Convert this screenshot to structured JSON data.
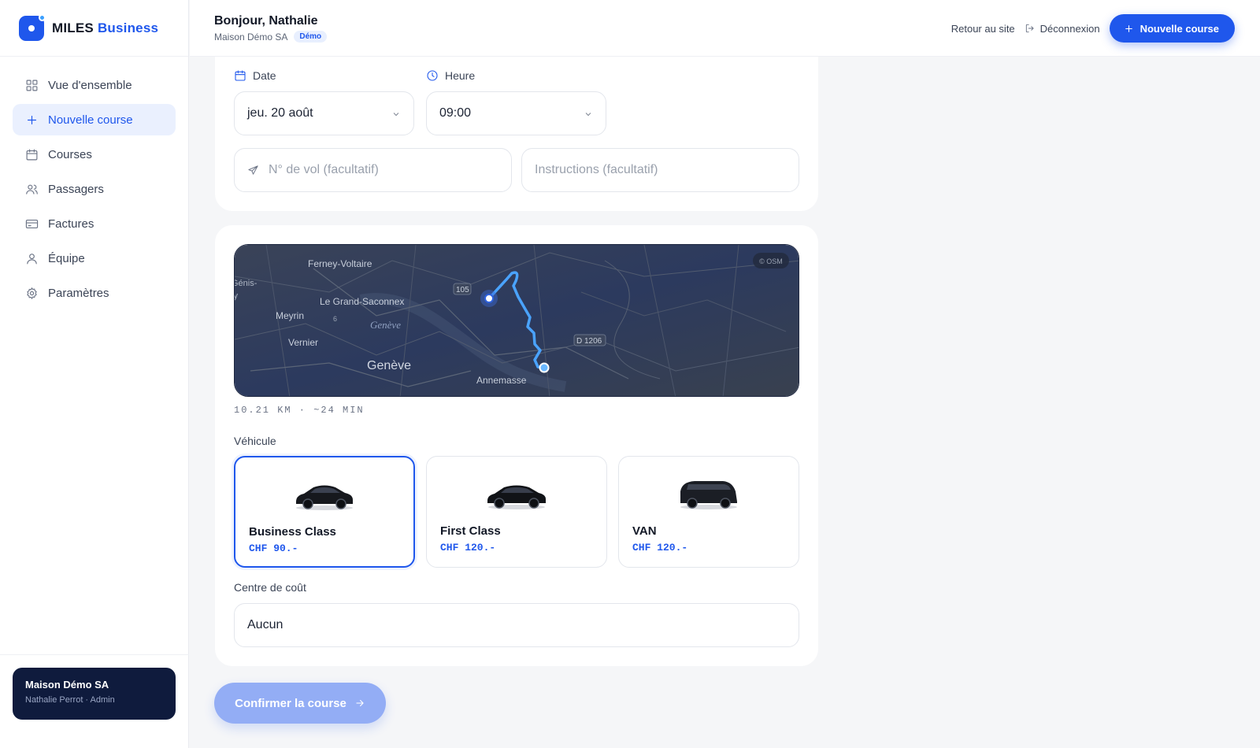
{
  "brand": {
    "name_part1": "MILES",
    "name_part2": "Business"
  },
  "sidebar": {
    "items": [
      {
        "label": "Vue d'ensemble",
        "icon": "grid-icon"
      },
      {
        "label": "Nouvelle course",
        "icon": "plus-icon",
        "active": true
      },
      {
        "label": "Courses",
        "icon": "calendar-icon"
      },
      {
        "label": "Passagers",
        "icon": "users-icon"
      },
      {
        "label": "Factures",
        "icon": "credit-card-icon"
      },
      {
        "label": "Équipe",
        "icon": "user-icon"
      },
      {
        "label": "Paramètres",
        "icon": "gear-icon"
      }
    ],
    "org_card": {
      "name": "Maison Démo SA",
      "sub": "Nathalie Perrot · Admin"
    }
  },
  "header": {
    "greeting": "Bonjour, Nathalie",
    "company": "Maison Démo SA",
    "badge": "Démo",
    "back_link": "Retour au site",
    "logout": "Déconnexion",
    "new_ride": "Nouvelle course"
  },
  "form": {
    "date_label": "Date",
    "date_value": "jeu. 20 août",
    "time_label": "Heure",
    "time_value": "09:00",
    "flight_placeholder": "N° de vol (facultatif)",
    "instructions_placeholder": "Instructions (facultatif)"
  },
  "map": {
    "labels": {
      "ferney": "Ferney-Voltaire",
      "genis": "Génis-",
      "genis2": "ly",
      "grand_saconnex": "Le Grand-Saconnex",
      "meyrin": "Meyrin",
      "geneve_lake": "Genève",
      "vernier": "Vernier",
      "geneve": "Genève",
      "annemasse": "Annemasse",
      "road_105": "105",
      "road_d1206": "D 1206",
      "road_6": "6"
    },
    "attribution": "© OSM"
  },
  "route_info": "10.21 KM · ~24 MIN",
  "vehicle": {
    "label": "Véhicule",
    "options": [
      {
        "name": "Business Class",
        "price": "CHF 90.-",
        "selected": true
      },
      {
        "name": "First Class",
        "price": "CHF 120.-",
        "selected": false
      },
      {
        "name": "VAN",
        "price": "CHF 120.-",
        "selected": false
      }
    ]
  },
  "cost_center": {
    "label": "Centre de coût",
    "value": "Aucun"
  },
  "confirm_label": "Confirmer la course",
  "colors": {
    "accent": "#1f57ec",
    "sidebar_card": "#0f1b3d",
    "route": "#4aa3ff"
  }
}
